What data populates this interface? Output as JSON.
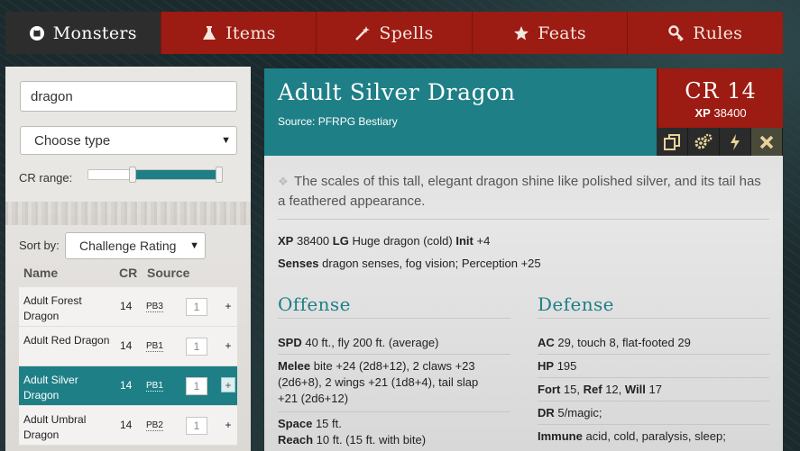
{
  "nav": {
    "items": [
      {
        "label": "Monsters",
        "icon": "github-icon",
        "active": true
      },
      {
        "label": "Items",
        "icon": "flask-icon",
        "active": false
      },
      {
        "label": "Spells",
        "icon": "wand-icon",
        "active": false
      },
      {
        "label": "Feats",
        "icon": "star-icon",
        "active": false
      },
      {
        "label": "Rules",
        "icon": "key-icon",
        "active": false
      }
    ]
  },
  "sidebar": {
    "search_value": "dragon",
    "type_select": "Choose type",
    "cr_label": "CR range:",
    "cr_range": {
      "low_fraction": 0.33,
      "high_fraction": 0.97
    },
    "sort_label": "Sort by:",
    "sort_select": "Challenge Rating",
    "columns": {
      "name": "Name",
      "cr": "CR",
      "source": "Source"
    },
    "rows": [
      {
        "name": "Adult Forest Dragon",
        "cr": "14",
        "source": "PB3",
        "qty": "1",
        "selected": false
      },
      {
        "name": "Adult Red Dragon",
        "cr": "14",
        "source": "PB1",
        "qty": "1",
        "selected": false
      },
      {
        "name": "Adult Silver Dragon",
        "cr": "14",
        "source": "PB1",
        "qty": "1",
        "selected": true
      },
      {
        "name": "Adult Umbral Dragon",
        "cr": "14",
        "source": "PB2",
        "qty": "1",
        "selected": false
      }
    ],
    "plus_label": "+"
  },
  "monster": {
    "title": "Adult Silver Dragon",
    "source": "Source: PFRPG Bestiary",
    "cr": "CR 14",
    "xp_label": "XP",
    "xp_value": "38400",
    "description": "The scales of this tall, elegant dragon shine like polished silver, and its tail has a feathered appearance.",
    "line1": {
      "xp_label": "XP",
      "xp": "38400",
      "align": "LG",
      "type": "Huge dragon (cold)",
      "init_label": "Init",
      "init": "+4"
    },
    "line2": {
      "senses_label": "Senses",
      "senses": "dragon senses, fog vision; Perception +25"
    },
    "offense": {
      "title": "Offense",
      "spd_label": "SPD",
      "spd": "40 ft., fly 200 ft. (average)",
      "melee_label": "Melee",
      "melee_1": "bite +24 (2d8+12), 2 claws +23",
      "melee_2": "(2d6+8), 2 wings +21 (1d8+4), tail slap",
      "melee_3": "+21 (2d6+12)",
      "space_label": "Space",
      "space": "15 ft.",
      "reach_label": "Reach",
      "reach": "10 ft. (15 ft. with bite)"
    },
    "defense": {
      "title": "Defense",
      "ac_label": "AC",
      "ac": "29, touch 8, flat-footed 29",
      "hp_label": "HP",
      "hp": "195",
      "fort_label": "Fort",
      "fort": "15,",
      "ref_label": "Ref",
      "ref": "12,",
      "will_label": "Will",
      "will": "17",
      "dr_label": "DR",
      "dr": "5/magic;",
      "immune_label": "Immune",
      "immune": "acid, cold, paralysis, sleep;"
    }
  },
  "colors": {
    "red": "#9c1b12",
    "teal": "#1e7f86",
    "dark": "#2d2d2d"
  },
  "tools": [
    "copy-icon",
    "gears-icon",
    "bolt-icon",
    "close-icon"
  ]
}
